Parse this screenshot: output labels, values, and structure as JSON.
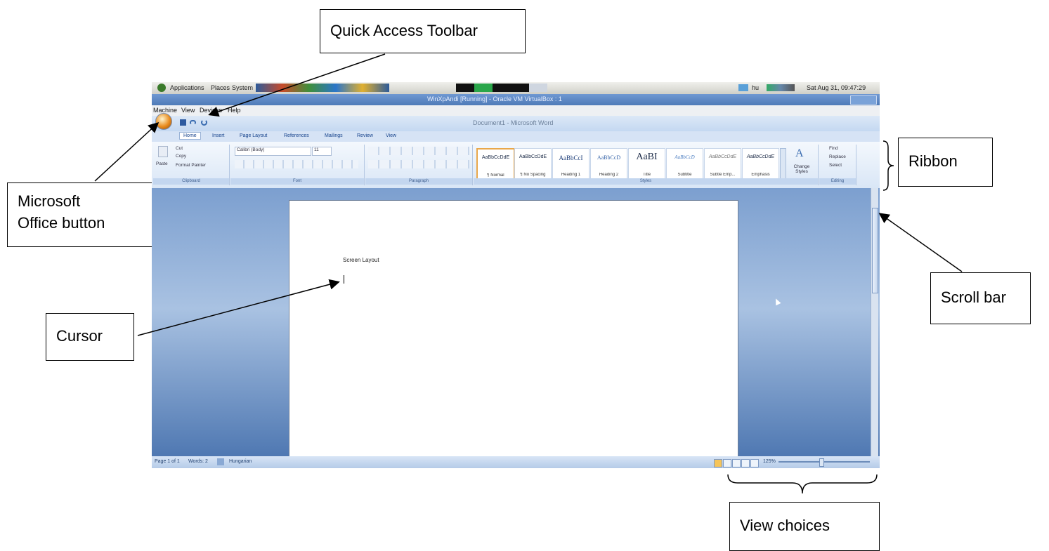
{
  "callouts": {
    "quick_access": "Quick Access Toolbar",
    "ribbon": "Ribbon",
    "office_button_line1": "Microsoft",
    "office_button_line2": "Office button",
    "scroll_bar": "Scroll bar",
    "cursor": "Cursor",
    "view_choices": "View choices"
  },
  "gnome_panel": {
    "menus": [
      "Applications",
      "Places",
      "System"
    ],
    "lang": "hu",
    "clock": "Sat Aug 31, 09:47:29"
  },
  "virtualbox": {
    "title": "WinXpAndi [Running] - Oracle VM VirtualBox : 1",
    "menu": [
      "Machine",
      "View",
      "Devices",
      "Help"
    ]
  },
  "word": {
    "window_title": "Document1 - Microsoft Word",
    "tabs": [
      "Home",
      "Insert",
      "Page Layout",
      "References",
      "Mailings",
      "Review",
      "View"
    ],
    "clipboard": {
      "paste": "Paste",
      "cut": "Cut",
      "copy": "Copy",
      "format_painter": "Format Painter",
      "label": "Clipboard"
    },
    "font": {
      "name": "Calibri (Body)",
      "size": "11",
      "label": "Font"
    },
    "paragraph": {
      "label": "Paragraph"
    },
    "styles": {
      "items": [
        {
          "preview": "AaBbCcDdE",
          "name": "¶ Normal"
        },
        {
          "preview": "AaBbCcDdE",
          "name": "¶ No Spacing"
        },
        {
          "preview": "AaBbCcI",
          "name": "Heading 1"
        },
        {
          "preview": "AaBbCcD",
          "name": "Heading 2"
        },
        {
          "preview": "AaBI",
          "name": "Title"
        },
        {
          "preview": "AaBbCcD",
          "name": "Subtitle"
        },
        {
          "preview": "AaBbCcDdE",
          "name": "Subtle Emp..."
        },
        {
          "preview": "AaBbCcDdE",
          "name": "Emphasis"
        }
      ],
      "change": "Change Styles",
      "label": "Styles"
    },
    "editing": {
      "find": "Find",
      "replace": "Replace",
      "select": "Select",
      "label": "Editing"
    },
    "document_text": "Screen Layout",
    "status": {
      "page": "Page 1 of 1",
      "words": "Words: 2",
      "language": "Hungarian",
      "zoom": "125%"
    }
  },
  "colors": {
    "ribbon": "#d9e6f6",
    "workspace": "#5b87bf",
    "title_bar": "#4f7bb8"
  }
}
